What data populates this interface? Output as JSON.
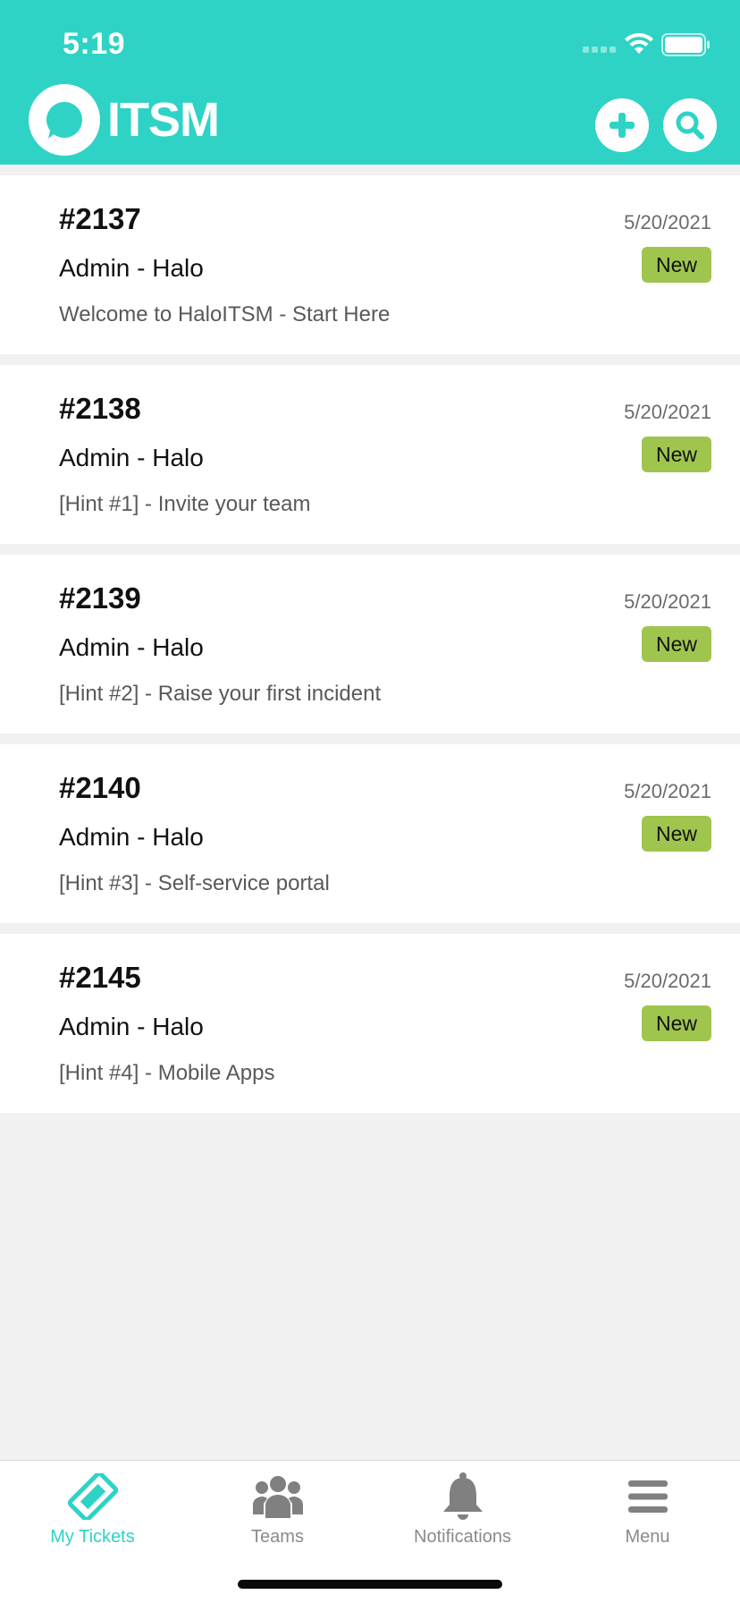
{
  "status_bar": {
    "time": "5:19"
  },
  "app": {
    "logo_text": "ITSM",
    "accent_color": "#2ed3c5",
    "badge_color": "#9fc54f"
  },
  "header": {
    "add_icon": "plus-icon",
    "search_icon": "search-icon"
  },
  "tickets": [
    {
      "id": "#2137",
      "date": "5/20/2021",
      "user": "Admin - Halo",
      "status": "New",
      "subject": "Welcome to HaloITSM - Start Here"
    },
    {
      "id": "#2138",
      "date": "5/20/2021",
      "user": "Admin - Halo",
      "status": "New",
      "subject": "[Hint #1] - Invite your team"
    },
    {
      "id": "#2139",
      "date": "5/20/2021",
      "user": "Admin - Halo",
      "status": "New",
      "subject": "[Hint #2] - Raise your first incident"
    },
    {
      "id": "#2140",
      "date": "5/20/2021",
      "user": "Admin - Halo",
      "status": "New",
      "subject": "[Hint #3] - Self-service portal"
    },
    {
      "id": "#2145",
      "date": "5/20/2021",
      "user": "Admin - Halo",
      "status": "New",
      "subject": "[Hint #4] - Mobile Apps"
    }
  ],
  "tabbar": {
    "tabs": [
      {
        "label": "My Tickets",
        "icon": "ticket-icon",
        "active": true
      },
      {
        "label": "Teams",
        "icon": "team-icon",
        "active": false
      },
      {
        "label": "Notifications",
        "icon": "bell-icon",
        "active": false
      },
      {
        "label": "Menu",
        "icon": "menu-icon",
        "active": false
      }
    ]
  }
}
